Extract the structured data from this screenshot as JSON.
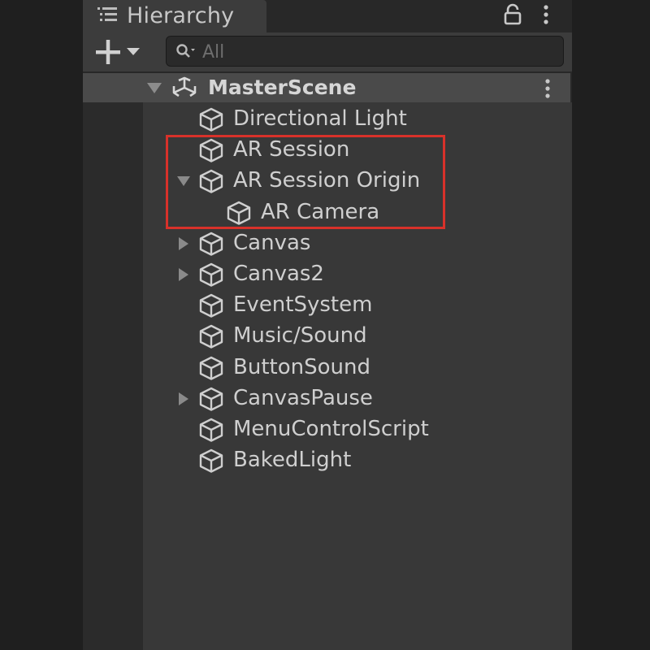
{
  "tab": {
    "title": "Hierarchy",
    "icon": "list-icon"
  },
  "toolbar": {
    "add_icon": "plus-icon",
    "search_placeholder": "All"
  },
  "scene": {
    "name": "MasterScene",
    "icon": "unity-logo-icon",
    "expanded": true
  },
  "items": [
    {
      "label": "Directional Light",
      "depth": 0,
      "fold": "none"
    },
    {
      "label": "AR Session",
      "depth": 0,
      "fold": "none"
    },
    {
      "label": "AR Session Origin",
      "depth": 0,
      "fold": "expanded"
    },
    {
      "label": "AR Camera",
      "depth": 1,
      "fold": "none"
    },
    {
      "label": "Canvas",
      "depth": 0,
      "fold": "collapsed"
    },
    {
      "label": "Canvas2",
      "depth": 0,
      "fold": "collapsed"
    },
    {
      "label": "EventSystem",
      "depth": 0,
      "fold": "none"
    },
    {
      "label": "Music/Sound",
      "depth": 0,
      "fold": "none"
    },
    {
      "label": "ButtonSound",
      "depth": 0,
      "fold": "none"
    },
    {
      "label": "CanvasPause",
      "depth": 0,
      "fold": "collapsed"
    },
    {
      "label": "MenuControlScript",
      "depth": 0,
      "fold": "none"
    },
    {
      "label": "BakedLight",
      "depth": 0,
      "fold": "none"
    }
  ],
  "highlight": {
    "color": "#d8312a",
    "covers": [
      "AR Session",
      "AR Session Origin",
      "AR Camera"
    ]
  },
  "colors": {
    "panel_bg": "#383838",
    "header_bg": "#3c3c3c",
    "scene_row_bg": "#4a4a4a",
    "text": "#cfcfcf"
  }
}
